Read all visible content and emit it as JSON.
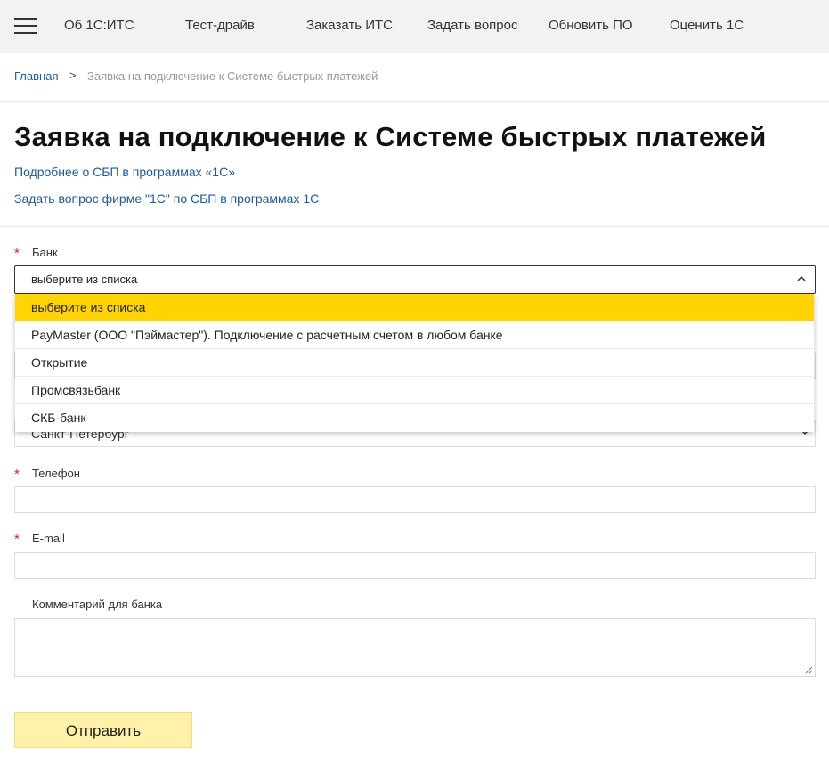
{
  "nav": {
    "items": [
      {
        "label": "Об 1С:ИТС"
      },
      {
        "label": "Тест-драйв"
      },
      {
        "label": "Заказать ИТС"
      },
      {
        "label": "Задать вопрос"
      },
      {
        "label": "Обновить ПО"
      },
      {
        "label": "Оценить 1С"
      }
    ]
  },
  "breadcrumb": {
    "home": "Главная",
    "separator": ">",
    "current": "Заявка на подключение к Системе быстрых платежей"
  },
  "page": {
    "title": "Заявка на подключение к Системе быстрых платежей",
    "link_more": "Подробнее о СБП в программах «1С»",
    "link_question": "Задать вопрос фирме \"1С\" по СБП в программах 1С"
  },
  "form": {
    "required_mark": "*",
    "bank": {
      "label": "Банк",
      "value": "выберите из списка",
      "options": [
        "выберите из списка",
        "PayMaster (ООО \"Пэймастер\"). Подключение с расчетным счетом в любом банке",
        "Открытие",
        "Промсвязьбанк",
        "СКБ-банк"
      ]
    },
    "city": {
      "value": "Санкт-Петербург"
    },
    "phone": {
      "label": "Телефон",
      "value": ""
    },
    "email": {
      "label": "E-mail",
      "value": ""
    },
    "comment": {
      "label": "Комментарий для банка",
      "value": ""
    },
    "submit_label": "Отправить"
  },
  "colors": {
    "accent": "#ffd400",
    "submit_bg": "#fff2a8",
    "link": "#1a5aa6",
    "required": "#e02020"
  }
}
